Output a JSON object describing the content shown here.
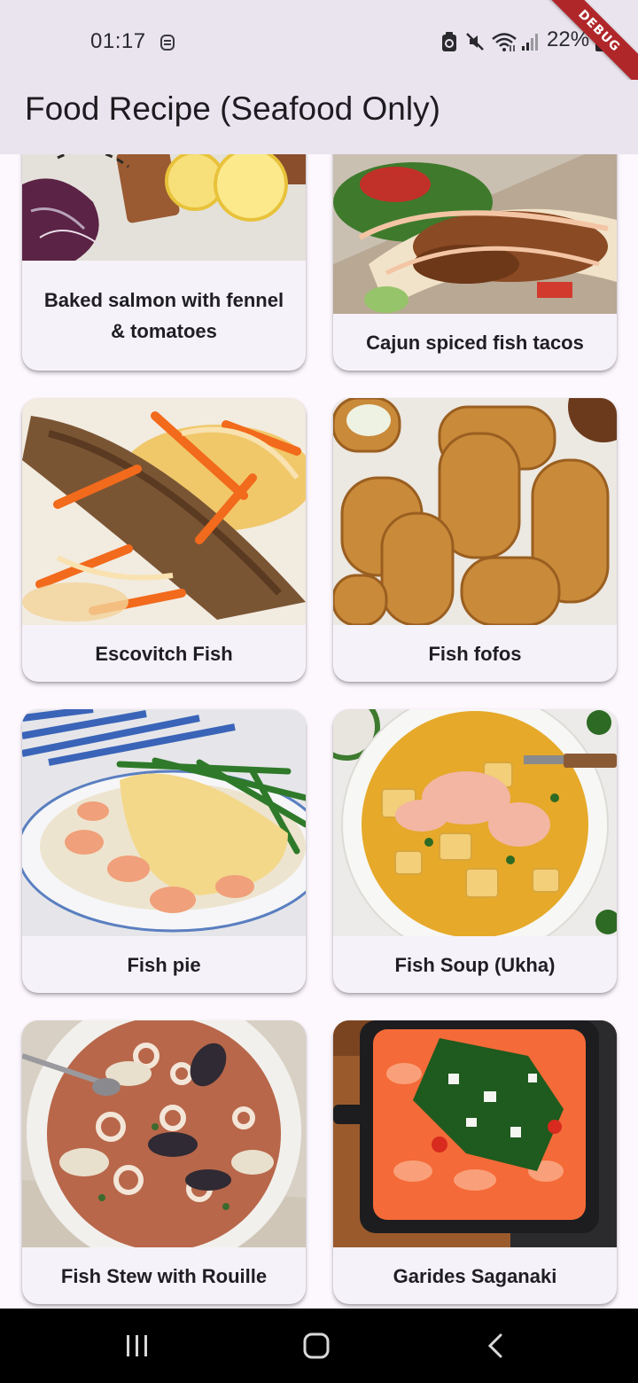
{
  "status_bar": {
    "time": "01:17",
    "battery_percent": "22%",
    "icons": [
      "sync-icon",
      "battery-saver-icon",
      "mute-icon",
      "wifi-icon",
      "signal-icon",
      "battery-icon"
    ]
  },
  "debug_banner": "DEBUG",
  "app_bar": {
    "title": "Food Recipe (Seafood Only)"
  },
  "recipes": [
    {
      "name": "Baked salmon with fennel & tomatoes",
      "image": "baked-salmon-photo"
    },
    {
      "name": "Cajun spiced fish tacos",
      "image": "fish-tacos-photo"
    },
    {
      "name": "Escovitch Fish",
      "image": "escovitch-fish-photo"
    },
    {
      "name": "Fish fofos",
      "image": "fish-fofos-photo"
    },
    {
      "name": "Fish pie",
      "image": "fish-pie-photo"
    },
    {
      "name": "Fish Soup (Ukha)",
      "image": "fish-soup-photo"
    },
    {
      "name": "Fish Stew with Rouille",
      "image": "fish-stew-photo"
    },
    {
      "name": "Garides Saganaki",
      "image": "garides-saganaki-photo"
    }
  ],
  "nav_bar": {
    "buttons": [
      "recent-apps-icon",
      "home-icon",
      "back-icon"
    ]
  },
  "colors": {
    "app_bar": "#e9e4ee",
    "background": "#fdf7fe",
    "card": "#f6f2f9",
    "debug": "#b0272a"
  }
}
